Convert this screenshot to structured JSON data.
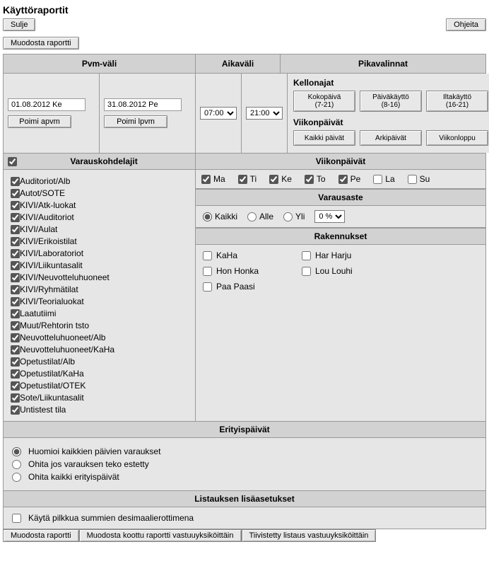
{
  "title": "Käyttöraportit",
  "topbar": {
    "close": "Sulje",
    "help": "Ohjeita"
  },
  "build": "Muodosta raportti",
  "headers": {
    "dateRange": "Pvm-väli",
    "timeRange": "Aikaväli",
    "quick": "Pikavalinnat",
    "targetTypes": "Varauskohdelajit",
    "weekdays": "Viikonpäivät",
    "occupancy": "Varausaste",
    "buildings": "Rakennukset",
    "special": "Erityispäivät",
    "listSettings": "Listauksen lisäasetukset"
  },
  "dates": {
    "start": "01.08.2012 Ke",
    "end": "31.08.2012 Pe",
    "pickStart": "Poimi apvm",
    "pickEnd": "Poimi lpvm"
  },
  "times": {
    "from": "07:00",
    "to": "21:00"
  },
  "quick": {
    "hoursLabel": "Kellonajat",
    "daysLabel": "Viikonpäivät",
    "hours": [
      {
        "l1": "Kokopäivä",
        "l2": "(7-21)"
      },
      {
        "l1": "Päiväkäyttö",
        "l2": "(8-16)"
      },
      {
        "l1": "Iltakäyttö",
        "l2": "(16-21)"
      }
    ],
    "days": [
      "Kaikki päivät",
      "Arkipäivät",
      "Viikonloppu"
    ]
  },
  "targetAll": true,
  "targets": [
    {
      "label": "Auditoriot/Alb",
      "checked": true
    },
    {
      "label": "Autot/SOTE",
      "checked": true
    },
    {
      "label": "KIVI/Atk-luokat",
      "checked": true
    },
    {
      "label": "KIVI/Auditoriot",
      "checked": true
    },
    {
      "label": "KIVI/Aulat",
      "checked": true
    },
    {
      "label": "KIVI/Erikoistilat",
      "checked": true
    },
    {
      "label": "KIVI/Laboratoriot",
      "checked": true
    },
    {
      "label": "KIVI/Liikuntasalit",
      "checked": true
    },
    {
      "label": "KIVI/Neuvotteluhuoneet",
      "checked": true
    },
    {
      "label": "KIVI/Ryhmätilat",
      "checked": true
    },
    {
      "label": "KIVI/Teorialuokat",
      "checked": true
    },
    {
      "label": "Laatutiimi",
      "checked": true
    },
    {
      "label": "Muut/Rehtorin tsto",
      "checked": true
    },
    {
      "label": "Neuvotteluhuoneet/Alb",
      "checked": true
    },
    {
      "label": "Neuvotteluhuoneet/KaHa",
      "checked": true
    },
    {
      "label": "Opetustilat/Alb",
      "checked": true
    },
    {
      "label": "Opetustilat/KaHa",
      "checked": true
    },
    {
      "label": "Opetustilat/OTEK",
      "checked": true
    },
    {
      "label": "Sote/Liikuntasalit",
      "checked": true
    },
    {
      "label": "Untistest tila",
      "checked": true
    }
  ],
  "weekdays": [
    {
      "label": "Ma",
      "checked": true
    },
    {
      "label": "Ti",
      "checked": true
    },
    {
      "label": "Ke",
      "checked": true
    },
    {
      "label": "To",
      "checked": true
    },
    {
      "label": "Pe",
      "checked": true
    },
    {
      "label": "La",
      "checked": false
    },
    {
      "label": "Su",
      "checked": false
    }
  ],
  "occupancy": {
    "all": "Kaikki",
    "under": "Alle",
    "over": "Yli",
    "pct": "0 %",
    "selected": "all"
  },
  "buildings": [
    {
      "label": "KaHa",
      "checked": false
    },
    {
      "label": "Har Harju",
      "checked": false
    },
    {
      "label": "Hon Honka",
      "checked": false
    },
    {
      "label": "Lou Louhi",
      "checked": false
    },
    {
      "label": "Paa Paasi",
      "checked": false
    }
  ],
  "special": {
    "opts": [
      "Huomioi kaikkien päivien varaukset",
      "Ohita jos varauksen teko estetty",
      "Ohita kaikki erityispäivät"
    ],
    "selected": 0
  },
  "listSettings": {
    "comma": {
      "label": "Käytä pilkkua summien desimaalierottimena",
      "checked": false
    }
  },
  "bottom": {
    "build": "Muodosta raportti",
    "buildCombined": "Muodosta koottu raportti vastuuyksiköittäin",
    "compact": "Tiivistetty listaus vastuuyksiköittäin"
  }
}
